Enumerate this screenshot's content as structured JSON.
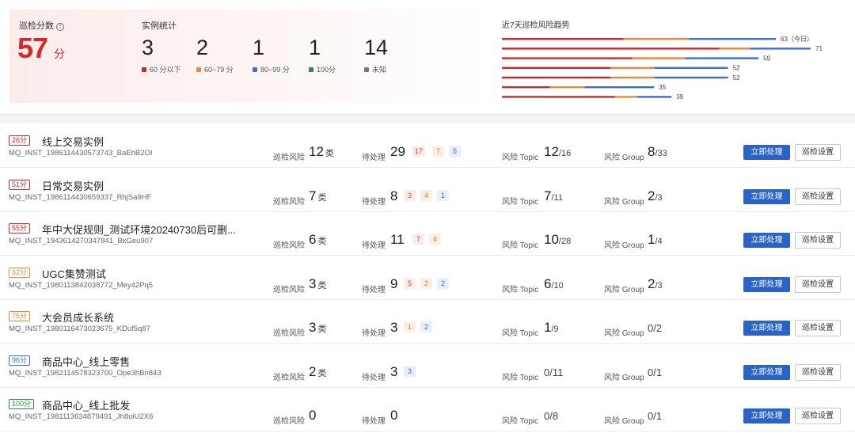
{
  "colors": {
    "red": "#c92a2a",
    "orange": "#e88a3a",
    "blue": "#3b6fd8",
    "green": "#2c8c43",
    "gray": "#777777"
  },
  "summary": {
    "score_label": "巡检分数",
    "info_icon": "info-icon",
    "score": "57",
    "score_unit": "分",
    "stats_title": "实例统计",
    "stats": [
      {
        "value": "3",
        "legend": "60 分以下",
        "color": "#c92a2a"
      },
      {
        "value": "2",
        "legend": "60~79 分",
        "color": "#e88a3a"
      },
      {
        "value": "1",
        "legend": "80~99 分",
        "color": "#3b6fd8"
      },
      {
        "value": "1",
        "legend": "100分",
        "color": "#2c8c43"
      },
      {
        "value": "14",
        "legend": "未知",
        "color": "#777777"
      }
    ],
    "trend_title": "近7天巡检风险趋势"
  },
  "chart_data": {
    "type": "bar",
    "orientation": "horizontal",
    "stacked": true,
    "categories": [
      "day1",
      "day2",
      "day3",
      "day4",
      "day5",
      "day6",
      "day7"
    ],
    "labels": [
      "63（今日）",
      "71",
      "59",
      "52",
      "52",
      "35",
      "39"
    ],
    "totals": [
      63,
      71,
      59,
      52,
      52,
      35,
      39
    ],
    "series": [
      {
        "color": "#c92a2a",
        "values": [
          28,
          50,
          30,
          25,
          25,
          11,
          26
        ]
      },
      {
        "color": "#e88a3a",
        "values": [
          15,
          7,
          12,
          10,
          10,
          8,
          5
        ]
      },
      {
        "color": "#3b6fd8",
        "values": [
          20,
          14,
          17,
          17,
          17,
          16,
          8
        ]
      }
    ],
    "xlim": [
      0,
      71
    ]
  },
  "labels": {
    "risk": "巡检风险",
    "risk_unit": "类",
    "pending": "待处理",
    "topic": "风险 Topic",
    "group": "风险 Group",
    "btn_handle": "立即处理",
    "btn_settings": "巡检设置"
  },
  "instances": [
    {
      "score": "26分",
      "level": "red",
      "name": "线上交易实例",
      "id": "MQ_INST_1986114430573743_BaEhB2OI",
      "risk": "12",
      "pending": "29",
      "chips": [
        [
          "17",
          "red"
        ],
        [
          "7",
          "orange"
        ],
        [
          "5",
          "blue"
        ]
      ],
      "topic_num": "12",
      "topic_den": "/16",
      "group_num": "8",
      "group_den": "/33"
    },
    {
      "score": "51分",
      "level": "red",
      "name": "日常交易实例",
      "id": "MQ_INST_1986114430659337_RhjSa9HF",
      "risk": "7",
      "pending": "8",
      "chips": [
        [
          "3",
          "red"
        ],
        [
          "4",
          "orange"
        ],
        [
          "1",
          "blue"
        ]
      ],
      "topic_num": "7",
      "topic_den": "/11",
      "group_num": "2",
      "group_den": "/3"
    },
    {
      "score": "55分",
      "level": "red",
      "name": "年中大促规则_测试环境20240730后可删...",
      "id": "MQ_INST_1943614270347841_BkGeu907",
      "risk": "6",
      "pending": "11",
      "chips": [
        [
          "7",
          "red"
        ],
        [
          "4",
          "orange"
        ]
      ],
      "topic_num": "10",
      "topic_den": "/28",
      "group_num": "1",
      "group_den": "/4"
    },
    {
      "score": "62分",
      "level": "orange",
      "name": "UGC集赞测试",
      "id": "MQ_INST_1980113842038772_Mey42Pq5",
      "risk": "3",
      "pending": "9",
      "chips": [
        [
          "5",
          "red"
        ],
        [
          "2",
          "orange"
        ],
        [
          "2",
          "blue"
        ]
      ],
      "topic_num": "6",
      "topic_den": "/10",
      "group_num": "2",
      "group_den": "/3"
    },
    {
      "score": "75分",
      "level": "orange",
      "name": "大会员成长系统",
      "id": "MQ_INST_1980116473023675_KDuf5q87",
      "risk": "3",
      "pending": "3",
      "chips": [
        [
          "1",
          "orange"
        ],
        [
          "2",
          "blue"
        ]
      ],
      "topic_num": "1",
      "topic_den": "/9",
      "group_num": "",
      "group_den": "0/2"
    },
    {
      "score": "96分",
      "level": "blue",
      "name": "商品中心_线上零售",
      "id": "MQ_INST_1982114578323700_Ope3hBn843",
      "risk": "2",
      "pending": "3",
      "chips": [
        [
          "3",
          "blue"
        ]
      ],
      "topic_num": "",
      "topic_den": "0/11",
      "group_num": "",
      "group_den": "0/1"
    },
    {
      "score": "100分",
      "level": "green",
      "name": "商品中心_线上批发",
      "id": "MQ_INST_1981113634879491_Jh8uiU2X6",
      "risk": "0",
      "pending": "0",
      "chips": [],
      "topic_num": "",
      "topic_den": "0/8",
      "group_num": "",
      "group_den": "0/1"
    }
  ]
}
